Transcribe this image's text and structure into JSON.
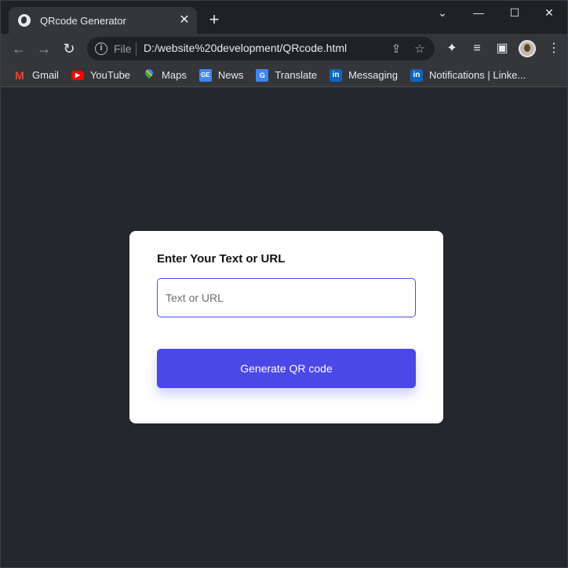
{
  "browser": {
    "tab": {
      "title": "QRcode Generator",
      "favicon": "globe-icon",
      "close_glyph": "✕"
    },
    "new_tab_glyph": "+",
    "window_controls": {
      "minimize_glyph": "—",
      "maximize_glyph": "☐",
      "close_glyph": "✕",
      "dropdown_glyph": "⌄"
    },
    "nav": {
      "back_glyph": "←",
      "forward_glyph": "→",
      "reload_glyph": "↻"
    },
    "omnibox": {
      "scheme": "File",
      "url": "D:/website%20development/QRcode.html",
      "info_glyph": "i",
      "share_glyph": "⇪",
      "star_glyph": "☆"
    },
    "toolbar_icons": {
      "extensions_glyph": "✦",
      "media_glyph": "≡",
      "sidepanel_glyph": "▣",
      "menu_glyph": "⋮"
    },
    "bookmarks": [
      {
        "label": "Gmail",
        "icon": "gmail-icon",
        "glyph": "M"
      },
      {
        "label": "YouTube",
        "icon": "youtube-icon",
        "glyph": "▶"
      },
      {
        "label": "Maps",
        "icon": "maps-icon",
        "glyph": ""
      },
      {
        "label": "News",
        "icon": "news-icon",
        "glyph": "GE"
      },
      {
        "label": "Translate",
        "icon": "translate-icon",
        "glyph": "G"
      },
      {
        "label": "Messaging",
        "icon": "linkedin-icon",
        "glyph": "in"
      },
      {
        "label": "Notifications | Linke...",
        "icon": "linkedin-icon",
        "glyph": "in"
      }
    ]
  },
  "page": {
    "card": {
      "title": "Enter Your Text or URL",
      "input_placeholder": "Text or URL",
      "input_value": "",
      "button_label": "Generate QR code"
    }
  },
  "colors": {
    "page_background": "#24272c",
    "accent": "#4a48e6",
    "card_background": "#ffffff"
  }
}
